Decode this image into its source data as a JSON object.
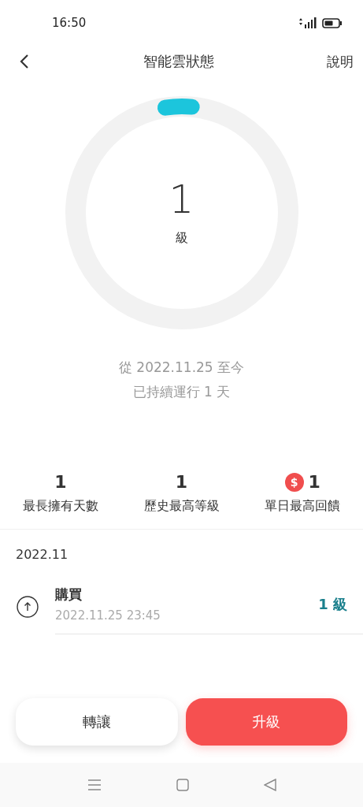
{
  "status_bar": {
    "time": "16:50"
  },
  "header": {
    "title": "智能雲狀態",
    "help": "說明"
  },
  "ring": {
    "level": 0.04,
    "value": "1",
    "unit": "級"
  },
  "since": [
    "從 2022.11.25 至今",
    "已持續運行 1 天"
  ],
  "stats": [
    {
      "kind": "plain",
      "value": "1",
      "label": "最長擁有天數"
    },
    {
      "kind": "plain",
      "value": "1",
      "label": "歷史最高等級"
    },
    {
      "kind": "coin",
      "coin": "$",
      "value": "1",
      "label": "單日最高回饋"
    }
  ],
  "month": "2022.11",
  "records": [
    {
      "title": "購買",
      "time": "2022.11.25 23:45",
      "level": "1 級"
    }
  ],
  "buttons": [
    {
      "kind": "secondary",
      "label": "轉讓"
    },
    {
      "kind": "primary",
      "label": "升級"
    }
  ]
}
